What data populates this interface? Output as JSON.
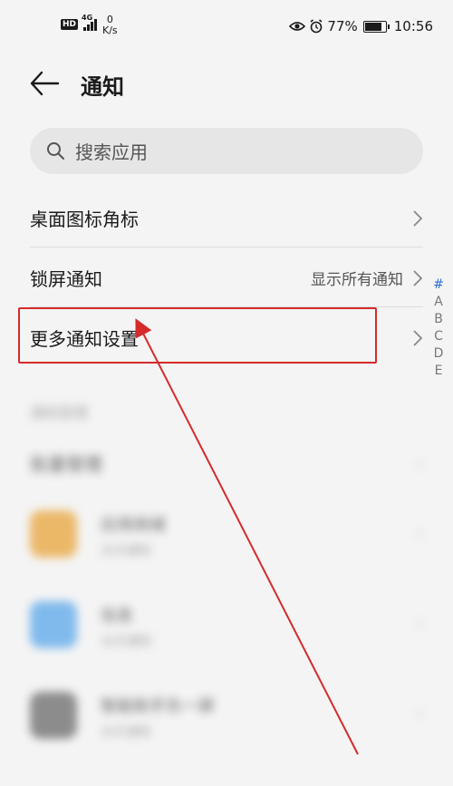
{
  "status_bar": {
    "hd": "HD",
    "network": "4G",
    "speed_value": "0",
    "speed_unit": "K/s",
    "battery": "77%",
    "battery_level": 0.77,
    "time": "10:56"
  },
  "header": {
    "title": "通知"
  },
  "search": {
    "placeholder": "搜索应用"
  },
  "rows": [
    {
      "label": "桌面图标角标",
      "value": ""
    },
    {
      "label": "锁屏通知",
      "value": "显示所有通知"
    },
    {
      "label": "更多通知设置",
      "value": ""
    }
  ],
  "alphabet_index": [
    "#",
    "A",
    "B",
    "C",
    "D",
    "E"
  ],
  "blurred_section": {
    "section_title": "通知管理",
    "batch_manage": "批量管理",
    "apps": [
      {
        "name": "应用商城",
        "subtitle": "允许通知",
        "icon_color": "#e8a43a"
      },
      {
        "name": "信息",
        "subtitle": "允许通知",
        "icon_color": "#5aa7ea"
      },
      {
        "name": "智能助手负一屏",
        "subtitle": "允许通知",
        "icon_color": "#6a6a6a"
      }
    ]
  },
  "annotation": {
    "color": "#d42a2a"
  }
}
